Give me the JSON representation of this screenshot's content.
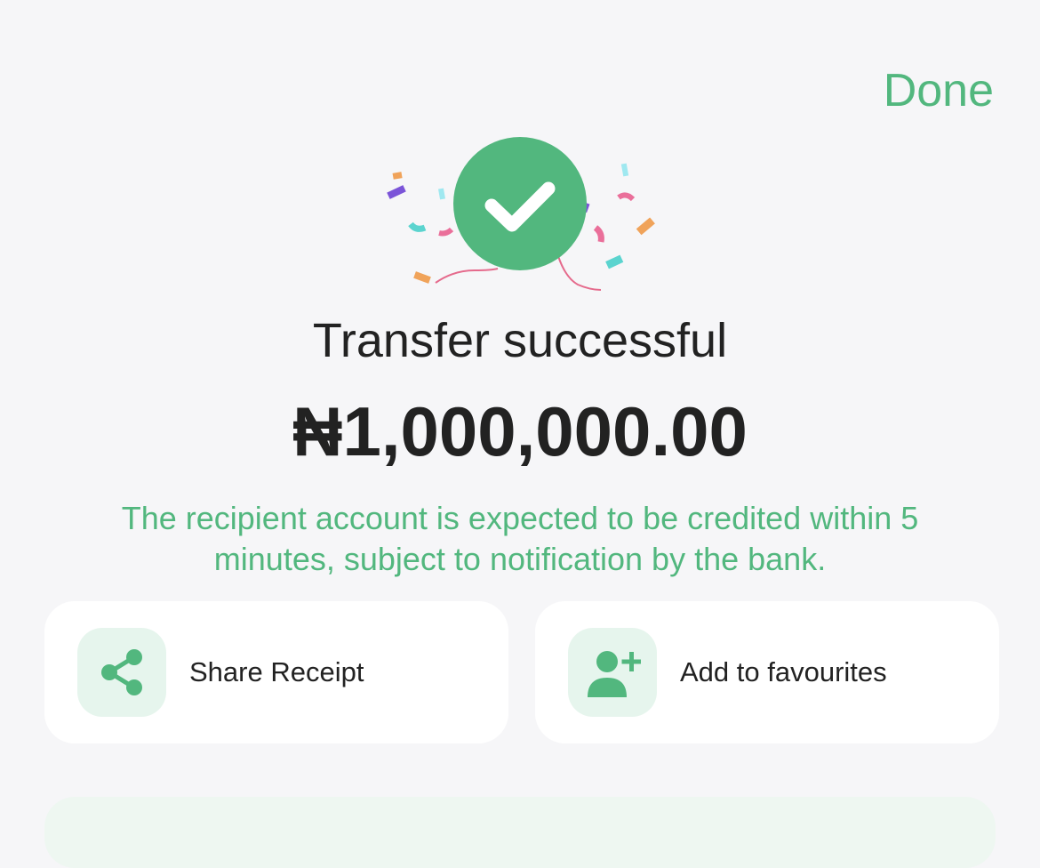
{
  "header": {
    "done_label": "Done"
  },
  "result": {
    "title": "Transfer successful",
    "amount": "₦1,000,000.00",
    "note": "The recipient account is expected to be credited within 5 minutes, subject to notification by the bank."
  },
  "actions": [
    {
      "label": "Share Receipt",
      "icon": "share-icon"
    },
    {
      "label": "Add to favourites",
      "icon": "add-user-icon"
    }
  ],
  "colors": {
    "accent": "#52b77e",
    "icon_bg": "#e6f5ed",
    "background": "#f6f6f8",
    "text": "#222222"
  }
}
